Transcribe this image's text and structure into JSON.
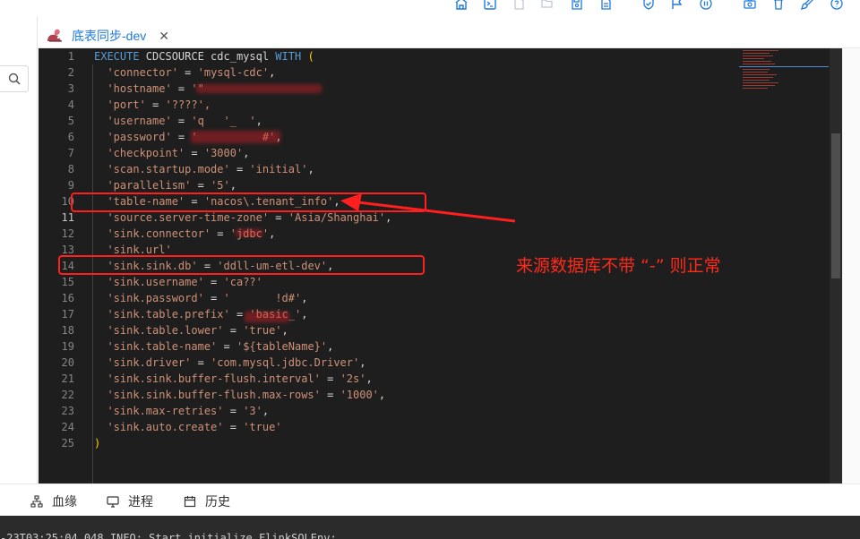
{
  "toolbar": {
    "icons": [
      "home-icon",
      "terminal-icon",
      "file-icon",
      "folder-open-icon",
      "save-icon",
      "clipboard-icon",
      "shield-check-icon",
      "flag-icon",
      "pause-icon",
      "camera-icon",
      "delete-icon",
      "brush-icon",
      "help-icon"
    ]
  },
  "tab": {
    "label": "底表同步-dev",
    "close": "✕"
  },
  "editor": {
    "line_numbers": [
      "1",
      "2",
      "3",
      "4",
      "5",
      "6",
      "7",
      "8",
      "9",
      "10",
      "11",
      "12",
      "13",
      "14",
      "15",
      "16",
      "17",
      "18",
      "19",
      "20",
      "21",
      "22",
      "23",
      "24",
      "25"
    ],
    "active_line": 11,
    "lines": {
      "l1_kw1": "EXECUTE",
      "l1_mid": " CDCSOURCE cdc_mysql ",
      "l1_kw2": "WITH",
      "l1_paren": "(",
      "l2_key": "'connector'",
      "l2_val": "'mysql-cdc'",
      "l3_key": "'hostname'",
      "l3_val": "'\"",
      "l4_key": "'port'",
      "l4_val": "'????',",
      "l5_key": "'username'",
      "l5_val": "'q   '_  '",
      "l6_key": "'password'",
      "l6_val": "'          #'",
      "l7_key": "'checkpoint'",
      "l7_val": "'3000'",
      "l8_key": "'scan.startup.mode'",
      "l8_val": "'initial'",
      "l9_key": "'parallelism'",
      "l9_val": "'5'",
      "l10_key": "'table-name'",
      "l10_val": "'nacos\\.tenant_info'",
      "l11_key": "'source.server-time-zone'",
      "l11_val": "'Asia/Shanghai'",
      "l12_key": "'sink.connector'",
      "l12_val": "'jdbc'",
      "l13_key": "'sink.url'",
      "l13_val": "",
      "l14_key": "'sink.sink.db'",
      "l14_val": "'ddll-um-etl-dev'",
      "l15_key": "'sink.username'",
      "l15_val": "'ca??'",
      "l16_key": "'sink.password'",
      "l16_val": "'       !d#'",
      "l17_key": "'sink.table.prefix'",
      "l17_val": "'basic_'",
      "l18_key": "'sink.table.lower'",
      "l18_val": "'true'",
      "l19_key": "'sink.table-name'",
      "l19_val": "'${tableName}'",
      "l20_key": "'sink.driver'",
      "l20_val": "'com.mysql.jdbc.Driver'",
      "l21_key": "'sink.sink.buffer-flush.interval'",
      "l21_val": "'2s'",
      "l22_key": "'sink.sink.buffer-flush.max-rows'",
      "l22_val": "'1000'",
      "l23_key": "'sink.max-retries'",
      "l23_val": "'3'",
      "l24_key": "'sink.auto.create'",
      "l24_val": "'true'",
      "l25_paren": ")"
    }
  },
  "annotation": {
    "text": "来源数据库不带 “-” 则正常",
    "color": "#ff2a1a"
  },
  "bottom_tabs": [
    {
      "label": "血缘",
      "icon": "lineage-icon"
    },
    {
      "label": "进程",
      "icon": "monitor-icon"
    },
    {
      "label": "历史",
      "icon": "calendar-icon"
    }
  ],
  "console": {
    "text": "-23T03:25:04.048 INFO: Start initialize FlinkSQLEnv:"
  },
  "colors": {
    "accent": "#1f7ae0",
    "editor_bg": "#1e1e1e",
    "string": "#ce9178",
    "keyword": "#569cd6",
    "annotation_red": "#ff1f1f"
  }
}
